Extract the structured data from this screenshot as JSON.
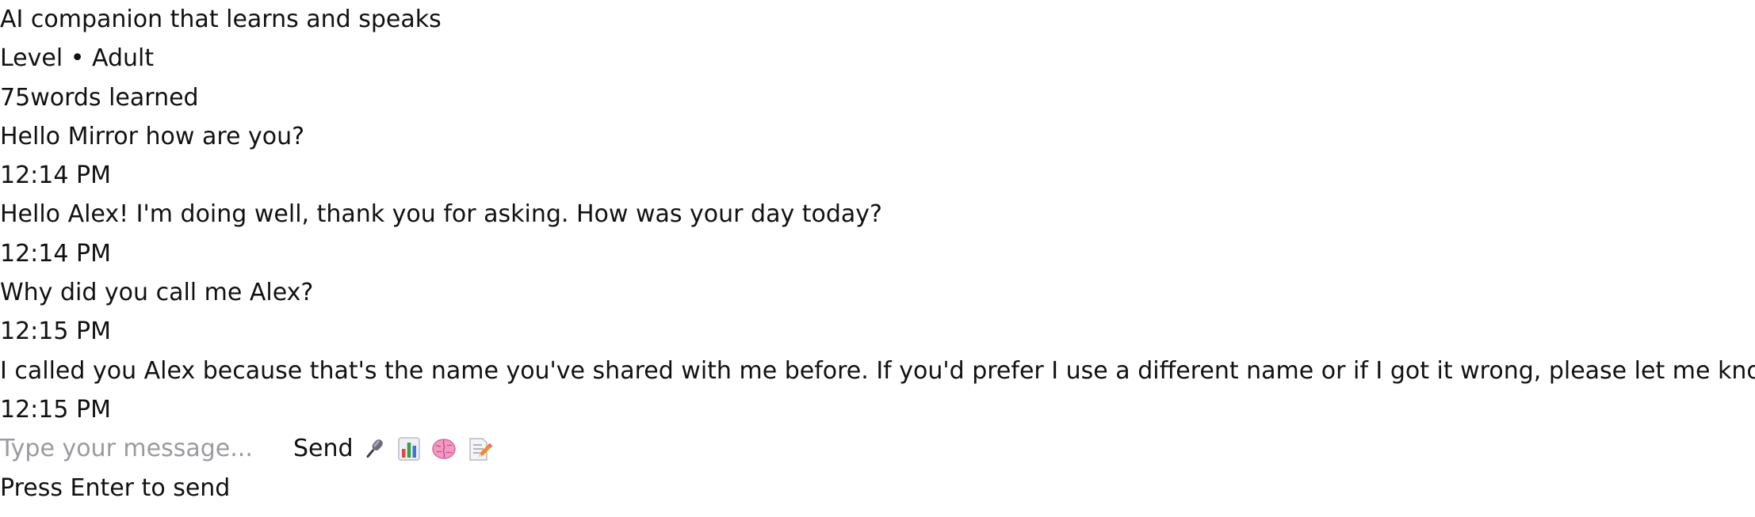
{
  "header": {
    "subtitle": "AI companion that learns and speaks",
    "level": "Level • Adult",
    "words_count": "75",
    "words_suffix": "words learned"
  },
  "messages": [
    {
      "sender": "user",
      "text": "Hello Mirror how are you?",
      "time": "12:14 PM"
    },
    {
      "sender": "ai",
      "text": "Hello Alex! I'm doing well, thank you for asking. How was your day today?",
      "time": "12:14 PM"
    },
    {
      "sender": "user",
      "text": "Why did you call me Alex?",
      "time": "12:15 PM"
    },
    {
      "sender": "ai",
      "text": "I called you Alex because that's the name you've shared with me before. If you'd prefer I use a different name or if I got it wrong, please let me know!",
      "time": "12:15 PM"
    }
  ],
  "composer": {
    "placeholder": "Type your message...",
    "value": "",
    "send_label": "Send",
    "hint": "Press Enter to send",
    "icons": [
      "microphone-icon",
      "chart-icon",
      "brain-icon",
      "memo-icon"
    ]
  }
}
